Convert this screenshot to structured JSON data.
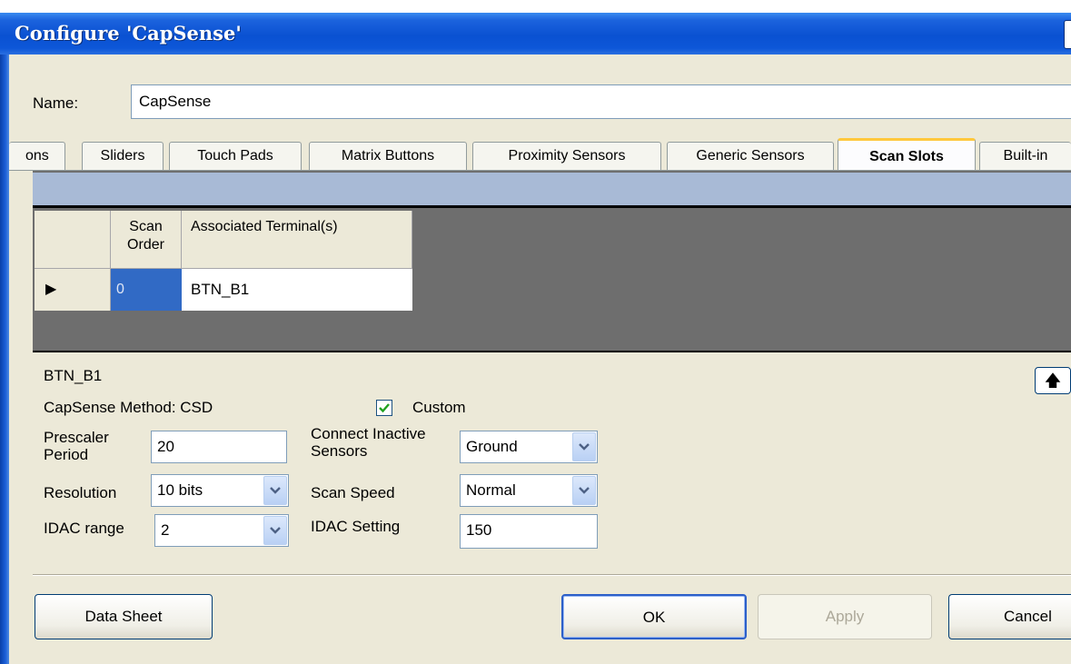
{
  "window": {
    "title": "Configure 'CapSense'"
  },
  "name_field": {
    "label": "Name:",
    "value": "CapSense"
  },
  "tabs": [
    {
      "label": "ons",
      "active": false
    },
    {
      "label": "Sliders",
      "active": false
    },
    {
      "label": "Touch Pads",
      "active": false
    },
    {
      "label": "Matrix Buttons",
      "active": false
    },
    {
      "label": "Proximity Sensors",
      "active": false
    },
    {
      "label": "Generic Sensors",
      "active": false
    },
    {
      "label": "Scan Slots",
      "active": true
    },
    {
      "label": "Built-in",
      "active": false
    }
  ],
  "grid": {
    "columns": [
      "Scan Order",
      "Associated Terminal(s)"
    ],
    "rows": [
      {
        "scan_order": "0",
        "terminal": "BTN_B1",
        "selected": true
      }
    ]
  },
  "sensor": {
    "name": "BTN_B1",
    "method": "CapSense Method: CSD",
    "custom_label": "Custom",
    "custom_checked": true,
    "prescaler_label": "Prescaler Period",
    "prescaler_value": "20",
    "resolution_label": "Resolution",
    "resolution_value": "10 bits",
    "idac_range_label": "IDAC range",
    "idac_range_value": "2",
    "connect_label": "Connect Inactive Sensors",
    "connect_value": "Ground",
    "scan_speed_label": "Scan Speed",
    "scan_speed_value": "Normal",
    "idac_setting_label": "IDAC Setting",
    "idac_setting_value": "150"
  },
  "buttons": {
    "datasheet": "Data Sheet",
    "ok": "OK",
    "apply": "Apply",
    "cancel": "Cancel"
  },
  "icons": {
    "up": "arrow-up-icon",
    "row_indicator": "row-pointer-icon",
    "dropdown": "chevron-down-icon"
  },
  "colors": {
    "titlebar": "#0a51d2",
    "dialog_bg": "#ece9d8",
    "selected_cell": "#316ac5",
    "active_tab_accent": "#ffc83c"
  }
}
